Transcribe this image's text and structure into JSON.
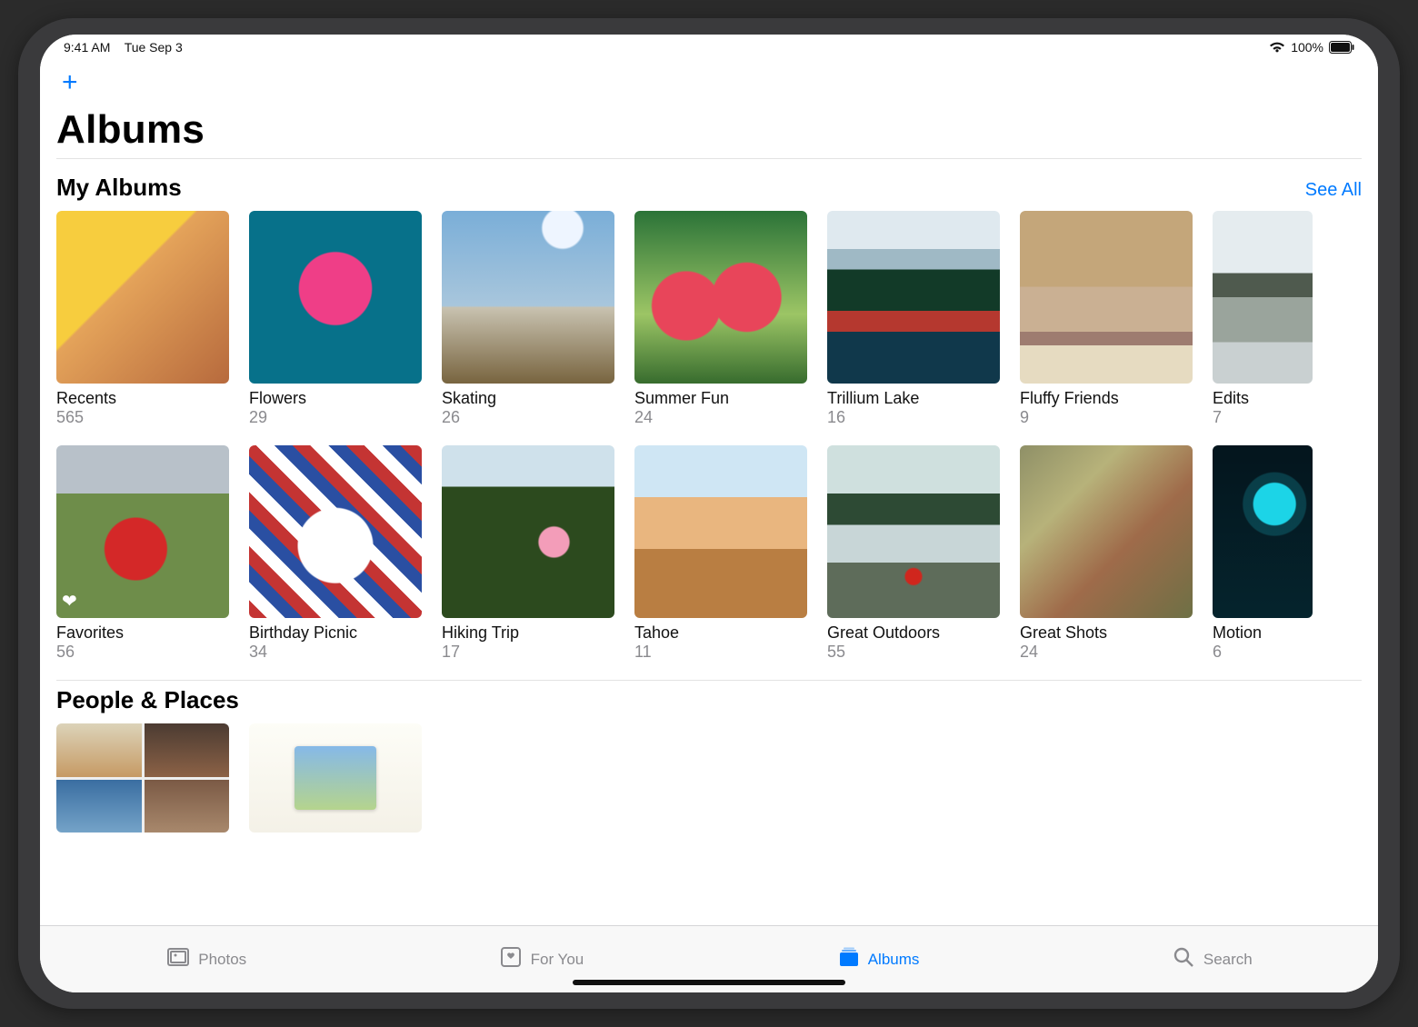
{
  "status": {
    "time": "9:41 AM",
    "date": "Tue Sep 3",
    "battery_pct": "100%"
  },
  "nav": {
    "plus_label": "+",
    "title": "Albums"
  },
  "sections": {
    "my_albums": {
      "title": "My Albums",
      "see_all": "See All",
      "row1": [
        {
          "name": "Recents",
          "count": "565"
        },
        {
          "name": "Flowers",
          "count": "29"
        },
        {
          "name": "Skating",
          "count": "26"
        },
        {
          "name": "Summer Fun",
          "count": "24"
        },
        {
          "name": "Trillium Lake",
          "count": "16"
        },
        {
          "name": "Fluffy Friends",
          "count": "9"
        },
        {
          "name": "Edits",
          "count": "7"
        }
      ],
      "row2": [
        {
          "name": "Favorites",
          "count": "56",
          "badge": "heart"
        },
        {
          "name": "Birthday Picnic",
          "count": "34"
        },
        {
          "name": "Hiking Trip",
          "count": "17"
        },
        {
          "name": "Tahoe",
          "count": "11"
        },
        {
          "name": "Great Outdoors",
          "count": "55"
        },
        {
          "name": "Great Shots",
          "count": "24"
        },
        {
          "name": "Motion",
          "count": "6"
        }
      ]
    },
    "people_places": {
      "title": "People & Places"
    }
  },
  "tabs": [
    {
      "id": "photos",
      "label": "Photos",
      "active": false
    },
    {
      "id": "for-you",
      "label": "For You",
      "active": false
    },
    {
      "id": "albums",
      "label": "Albums",
      "active": true
    },
    {
      "id": "search",
      "label": "Search",
      "active": false
    }
  ]
}
